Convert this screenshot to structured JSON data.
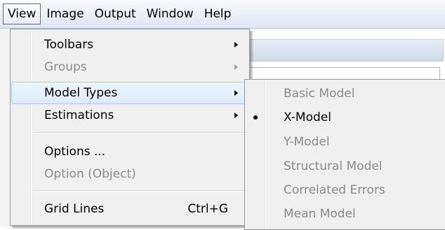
{
  "menubar": {
    "items": [
      {
        "label": "View",
        "active": true
      },
      {
        "label": "Image"
      },
      {
        "label": "Output"
      },
      {
        "label": "Window"
      },
      {
        "label": "Help"
      }
    ]
  },
  "view_menu": {
    "items": [
      {
        "label": "Toolbars",
        "submenu": true,
        "enabled": true
      },
      {
        "label": "Groups",
        "submenu": true,
        "enabled": false
      },
      {
        "label": "Model Types",
        "submenu": true,
        "enabled": true,
        "highlighted": true
      },
      {
        "label": "Estimations",
        "submenu": true,
        "enabled": true
      },
      {
        "label": "Options ...",
        "enabled": true
      },
      {
        "label": "Option (Object)",
        "enabled": false
      },
      {
        "label": "Grid Lines",
        "shortcut": "Ctrl+G",
        "enabled": true
      }
    ]
  },
  "model_types_submenu": {
    "items": [
      {
        "label": "Basic Model",
        "enabled": false
      },
      {
        "label": "X-Model",
        "enabled": true,
        "checked": true
      },
      {
        "label": "Y-Model",
        "enabled": false
      },
      {
        "label": "Structural Model",
        "enabled": false
      },
      {
        "label": "Correlated Errors",
        "enabled": false
      },
      {
        "label": "Mean Model",
        "enabled": false
      }
    ]
  },
  "colors": {
    "menu_bg": "#f0f0f0",
    "highlight_border": "#a8cbf0",
    "disabled_text": "#8a8a8a"
  }
}
